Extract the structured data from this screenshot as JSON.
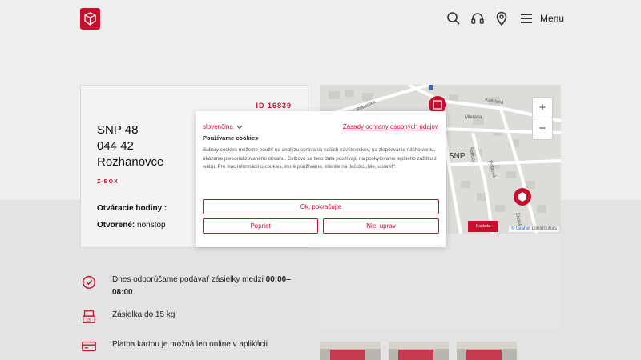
{
  "header": {
    "menu_label": "Menu"
  },
  "card": {
    "id": "ID 16839",
    "address_line1": "SNP 48",
    "address_line2": "044 42",
    "address_line3": "Rozhanovce",
    "type": "Z-BOX",
    "hours_label": "Otváracie hodiny :",
    "open_label": "Otvorené:",
    "open_value": " nonstop"
  },
  "map": {
    "zoom_in": "+",
    "zoom_out": "−",
    "badge": "Packeta",
    "attribution_link": "© Leaflet",
    "attribution_rest": " contributors",
    "streets": [
      "Rybárska",
      "Kostolná",
      "Mierova",
      "Školská",
      "Poštová",
      "Sobody",
      "SNP"
    ]
  },
  "info": {
    "row1_text": "Dnes odporúčame podávať zásielky medzi ",
    "row1_bold": "00:00–08:00",
    "row2_text": "Zásielka do 15 kg",
    "row3_text": "Platba kartou je možná len online v aplikácii"
  },
  "cookie": {
    "language": "slovenčina",
    "policy_link": "Zásady ochrany osobných údajov",
    "title": "Používame cookies",
    "body": "Súbory cookies môžeme použiť na analýzu správania našich návštevníkov, na zlepšovanie nášho webu, ukázanie personalizovaného obsahu. Celkovo sa tieto dáta používajú na poskytovanie lepšieho zážitku z webu. Pre viac informácií o cookies, ktoré používame, kliknite na tlačidlo „Nie, upraviť“.",
    "accept": "Ok, pokračujte",
    "reject": "Popriet",
    "customize": "Nie, uprav"
  },
  "colors": {
    "brand": "#c8102e"
  }
}
